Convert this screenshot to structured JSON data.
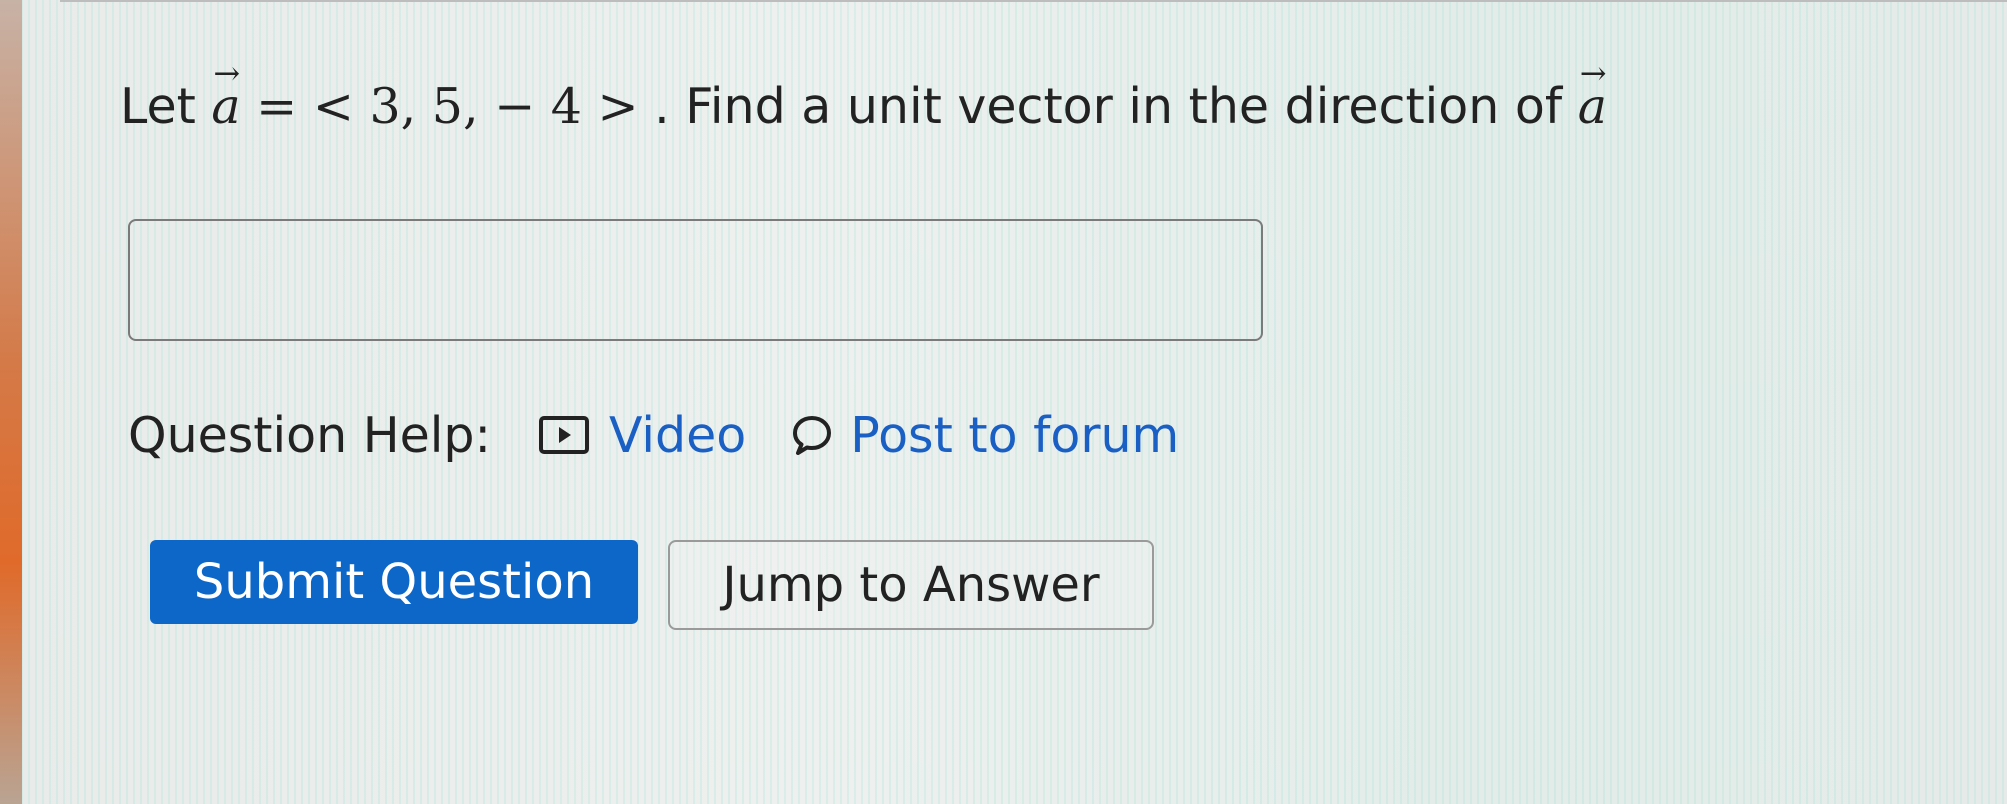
{
  "question": {
    "prefix": "Let",
    "vector_symbol": "a",
    "arrow": "→",
    "equals": "=",
    "vector_value": "< 3, 5, − 4 >",
    "suffix": ". Find a unit vector in the direction of"
  },
  "answer": {
    "value": "",
    "placeholder": ""
  },
  "help": {
    "label": "Question Help:",
    "video_label": "Video",
    "forum_label": "Post to forum",
    "video_icon": "video-play-icon",
    "forum_icon": "chat-bubble-icon"
  },
  "buttons": {
    "submit_label": "Submit Question",
    "jump_label": "Jump to Answer"
  },
  "colors": {
    "link": "#1a5fc4",
    "primary_button": "#0d67c8",
    "text": "#222222"
  }
}
